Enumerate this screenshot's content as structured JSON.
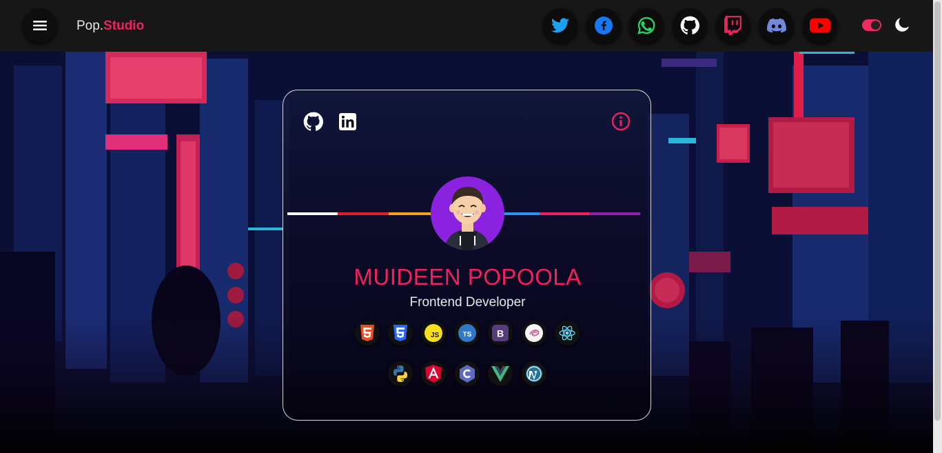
{
  "header": {
    "brand_prefix": "Pop.",
    "brand_suffix": "Studio",
    "menu_icon": "hamburger-icon",
    "social": [
      {
        "name": "twitter",
        "icon": "twitter-icon",
        "color": "#1da1f2"
      },
      {
        "name": "facebook",
        "icon": "facebook-icon",
        "color": "#1877f2"
      },
      {
        "name": "whatsapp",
        "icon": "whatsapp-icon",
        "color": "#25d366"
      },
      {
        "name": "github",
        "icon": "github-icon",
        "color": "#ffffff"
      },
      {
        "name": "twitch",
        "icon": "twitch-icon",
        "color": "#f0215c"
      },
      {
        "name": "discord",
        "icon": "discord-icon",
        "color": "#7289da"
      },
      {
        "name": "youtube",
        "icon": "youtube-icon",
        "color": "#ff0000"
      }
    ],
    "theme_toggle_icon": "toggle-icon",
    "theme_icon": "moon-icon"
  },
  "card": {
    "links": [
      {
        "icon": "github-icon"
      },
      {
        "icon": "linkedin-icon"
      }
    ],
    "info_icon": "info-icon",
    "name": "MUIDEEN POPOOLA",
    "role": "Frontend Developer",
    "skills_row1": [
      "html5-icon",
      "css3-icon",
      "javascript-icon",
      "typescript-icon",
      "bootstrap-icon",
      "sass-icon",
      "react-icon"
    ],
    "skills_row2": [
      "python-icon",
      "angular-icon",
      "c-icon",
      "vue-icon",
      "wordpress-icon"
    ]
  },
  "colors": {
    "accent": "#f0215c",
    "topbar": "#171717",
    "avatar_bg": "#8a22e0"
  }
}
